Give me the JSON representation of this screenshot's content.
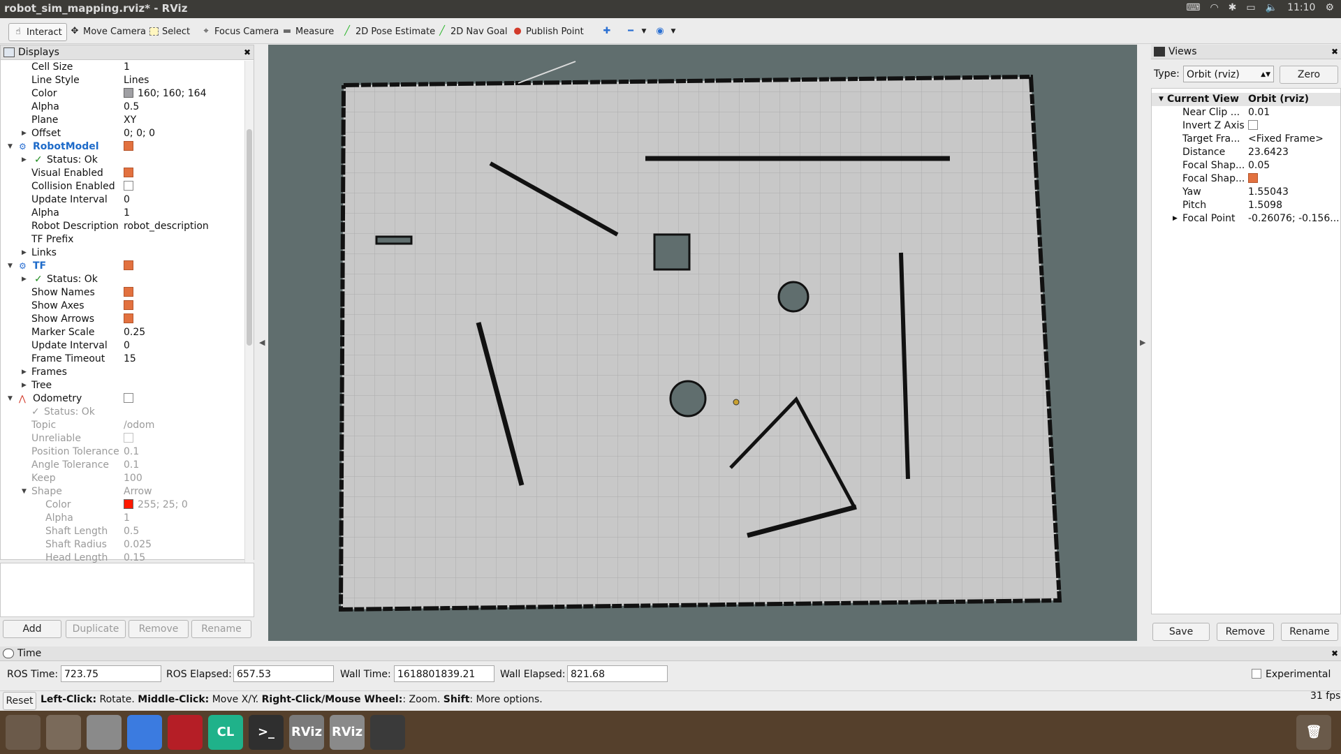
{
  "window": {
    "title": "robot_sim_mapping.rviz* - RViz",
    "clock": "11:10"
  },
  "toolbar": {
    "tools": [
      {
        "label": "Interact",
        "icon": "interact-icon"
      },
      {
        "label": "Move Camera",
        "icon": "move-camera-icon"
      },
      {
        "label": "Select",
        "icon": "select-icon"
      },
      {
        "label": "Focus Camera",
        "icon": "focus-camera-icon"
      },
      {
        "label": "Measure",
        "icon": "measure-icon"
      },
      {
        "label": "2D Pose Estimate",
        "icon": "pose-estimate-icon"
      },
      {
        "label": "2D Nav Goal",
        "icon": "nav-goal-icon"
      },
      {
        "label": "Publish Point",
        "icon": "publish-point-icon"
      }
    ]
  },
  "displays": {
    "header": "Displays",
    "rows": {
      "cell_size": {
        "label": "Cell Size",
        "value": "1"
      },
      "line_style": {
        "label": "Line Style",
        "value": "Lines"
      },
      "color": {
        "label": "Color",
        "value": "160; 160; 164",
        "swatch": "#a0a0a4"
      },
      "alpha": {
        "label": "Alpha",
        "value": "0.5"
      },
      "plane": {
        "label": "Plane",
        "value": "XY"
      },
      "offset": {
        "label": "Offset",
        "value": "0; 0; 0"
      },
      "robot_model": {
        "label": "RobotModel"
      },
      "rm_status": {
        "label": "Status: Ok"
      },
      "visual_enabled": {
        "label": "Visual Enabled"
      },
      "collision_enabled": {
        "label": "Collision Enabled"
      },
      "rm_update_interval": {
        "label": "Update Interval",
        "value": "0"
      },
      "rm_alpha": {
        "label": "Alpha",
        "value": "1"
      },
      "robot_description": {
        "label": "Robot Description",
        "value": "robot_description"
      },
      "tf_prefix": {
        "label": "TF Prefix",
        "value": ""
      },
      "links": {
        "label": "Links"
      },
      "tf": {
        "label": "TF"
      },
      "tf_status": {
        "label": "Status: Ok"
      },
      "show_names": {
        "label": "Show Names"
      },
      "show_axes": {
        "label": "Show Axes"
      },
      "show_arrows": {
        "label": "Show Arrows"
      },
      "marker_scale": {
        "label": "Marker Scale",
        "value": "0.25"
      },
      "tf_update_interval": {
        "label": "Update Interval",
        "value": "0"
      },
      "frame_timeout": {
        "label": "Frame Timeout",
        "value": "15"
      },
      "frames": {
        "label": "Frames"
      },
      "tree": {
        "label": "Tree"
      },
      "odometry": {
        "label": "Odometry"
      },
      "odom_status": {
        "label": "Status: Ok"
      },
      "topic": {
        "label": "Topic",
        "value": "/odom"
      },
      "unreliable": {
        "label": "Unreliable"
      },
      "position_tolerance": {
        "label": "Position Tolerance",
        "value": "0.1"
      },
      "angle_tolerance": {
        "label": "Angle Tolerance",
        "value": "0.1"
      },
      "keep": {
        "label": "Keep",
        "value": "100"
      },
      "shape": {
        "label": "Shape",
        "value": "Arrow"
      },
      "shape_color": {
        "label": "Color",
        "value": "255; 25; 0",
        "swatch": "#ff1900"
      },
      "shape_alpha": {
        "label": "Alpha",
        "value": "1"
      },
      "shaft_length": {
        "label": "Shaft Length",
        "value": "0.5"
      },
      "shaft_radius": {
        "label": "Shaft Radius",
        "value": "0.025"
      },
      "head_length": {
        "label": "Head Length",
        "value": "0.15"
      }
    },
    "buttons": {
      "add": "Add",
      "duplicate": "Duplicate",
      "remove": "Remove",
      "rename": "Rename"
    }
  },
  "views": {
    "header": "Views",
    "type_label": "Type:",
    "type_value": "Orbit (rviz)",
    "zero_label": "Zero",
    "current_view": {
      "label": "Current View",
      "value": "Orbit (rviz)"
    },
    "props": [
      {
        "label": "Near Clip ...",
        "value": "0.01"
      },
      {
        "label": "Invert Z Axis",
        "value": ""
      },
      {
        "label": "Target Fra...",
        "value": "<Fixed Frame>"
      },
      {
        "label": "Distance",
        "value": "23.6423"
      },
      {
        "label": "Focal Shap...",
        "value": "0.05"
      },
      {
        "label": "Focal Shap...",
        "value": ""
      },
      {
        "label": "Yaw",
        "value": "1.55043"
      },
      {
        "label": "Pitch",
        "value": "1.5098"
      },
      {
        "label": "Focal Point",
        "value": "-0.26076; -0.156..."
      }
    ],
    "buttons": {
      "save": "Save",
      "remove": "Remove",
      "rename": "Rename"
    }
  },
  "time": {
    "header": "Time",
    "ros_time_label": "ROS Time:",
    "ros_time": "723.75",
    "ros_elapsed_label": "ROS Elapsed:",
    "ros_elapsed": "657.53",
    "wall_time_label": "Wall Time:",
    "wall_time": "1618801839.21",
    "wall_elapsed_label": "Wall Elapsed:",
    "wall_elapsed": "821.68",
    "experimental": "Experimental"
  },
  "status": {
    "reset": "Reset",
    "k1": "Left-Click:",
    "t1": " Rotate. ",
    "k2": "Middle-Click:",
    "t2": " Move X/Y. ",
    "k3": "Right-Click/Mouse Wheel:",
    "t3": ": Zoom. ",
    "k4": "Shift",
    "t4": ": More options.",
    "fps": "31 fps"
  },
  "taskbar": {
    "apps": [
      {
        "name": "ubuntu-dash",
        "label": "",
        "color": "#6b5a4a"
      },
      {
        "name": "files",
        "label": "",
        "color": "#7a6a5a"
      },
      {
        "name": "system-settings",
        "label": "",
        "color": "#8a8a8a"
      },
      {
        "name": "chrome",
        "label": "",
        "color": "#3b7be0"
      },
      {
        "name": "gitk",
        "label": "",
        "color": "#b51e26"
      },
      {
        "name": "clion",
        "label": "CL",
        "color": "#1fb28a"
      },
      {
        "name": "terminal",
        "label": ">_",
        "color": "#2f2f2f"
      },
      {
        "name": "rviz-1",
        "label": "RViz",
        "color": "#7a7a7a"
      },
      {
        "name": "rviz-2",
        "label": "RViz",
        "color": "#8a8a8a"
      },
      {
        "name": "sublime",
        "label": "",
        "color": "#3a3a3a"
      }
    ]
  },
  "colors": {
    "accent": "#e2713f",
    "selected_text": "#1e6bc9",
    "map_free": "#c8c8c8",
    "map_wall": "#111111",
    "viewport_bg": "#606e6e"
  }
}
